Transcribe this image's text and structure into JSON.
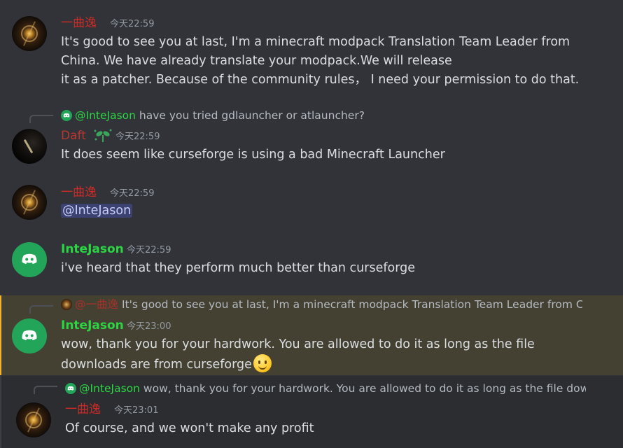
{
  "messages": [
    {
      "author": "一曲逸",
      "timestamp": "今天22:59",
      "lines": [
        "It's good to see you at last, I'm a minecraft modpack Translation Team Leader from",
        "China. We have already translate your modpack.We will release",
        "it as a patcher. Because of the community rules， I need your permission to do that."
      ]
    },
    {
      "reply_author": "@InteJason",
      "reply_text": "have you tried gdlauncher or atlauncher?",
      "author": "Daft",
      "timestamp": "今天22:59",
      "lines": [
        "It does seem like curseforge is using a bad Minecraft Launcher"
      ]
    },
    {
      "author": "一曲逸",
      "timestamp": "今天22:59",
      "mention": "@InteJason"
    },
    {
      "author": "InteJason",
      "timestamp": "今天22:59",
      "lines": [
        "i've heard that they perform much better than curseforge"
      ]
    },
    {
      "reply_author": "@一曲逸",
      "reply_text": "It's good to see you at last, I'm a minecraft modpack Translation Team Leader from Chin",
      "author": "InteJason",
      "timestamp": "今天23:00",
      "lines": [
        "wow, thank you for your hardwork. You are allowed to do it as long as the file",
        "downloads are from curseforge"
      ]
    },
    {
      "reply_author": "@InteJason",
      "reply_text": "wow, thank you for your hardwork. You are allowed to do it as long as the file downlo",
      "author": "一曲逸",
      "timestamp": "今天23:01",
      "lines": [
        "Of course, and we won't make any profit"
      ]
    }
  ],
  "icons": {
    "discord_avatar": "discord-logo-icon",
    "emoji": "slightly-smiling-face-emoji",
    "badge": "sprout-badge-icon"
  },
  "colors": {
    "background": "#313338",
    "highlight": "#444133",
    "mention_bg": "#3c4270",
    "green_name": "#2cd643",
    "red_name": "#cb2b26",
    "discord_green": "#23a559"
  }
}
